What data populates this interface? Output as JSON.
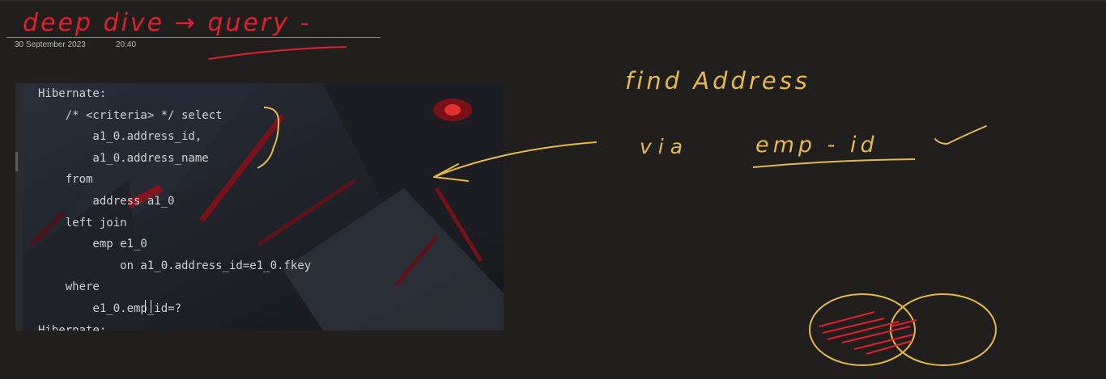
{
  "note": {
    "title_ink": "deep dive → query -",
    "date": "30 September 2023",
    "time": "20:40"
  },
  "code_screenshot": {
    "lines": [
      "Hibernate:",
      "    /* <criteria> */ select",
      "        a1_0.address_id,",
      "        a1_0.address_name",
      "    from",
      "        address a1_0",
      "    left join",
      "        emp e1_0",
      "            on a1_0.address_id=e1_0.fkey",
      "    where",
      "        e1_0.emp_id=?",
      "Hibernate:"
    ]
  },
  "annotations": {
    "find_address": "find   Address",
    "via": "via",
    "emp_id": "emp - id"
  },
  "colors": {
    "background": "#201f1d",
    "ink_red": "#e0202a",
    "ink_yellow": "#e8b84a"
  }
}
